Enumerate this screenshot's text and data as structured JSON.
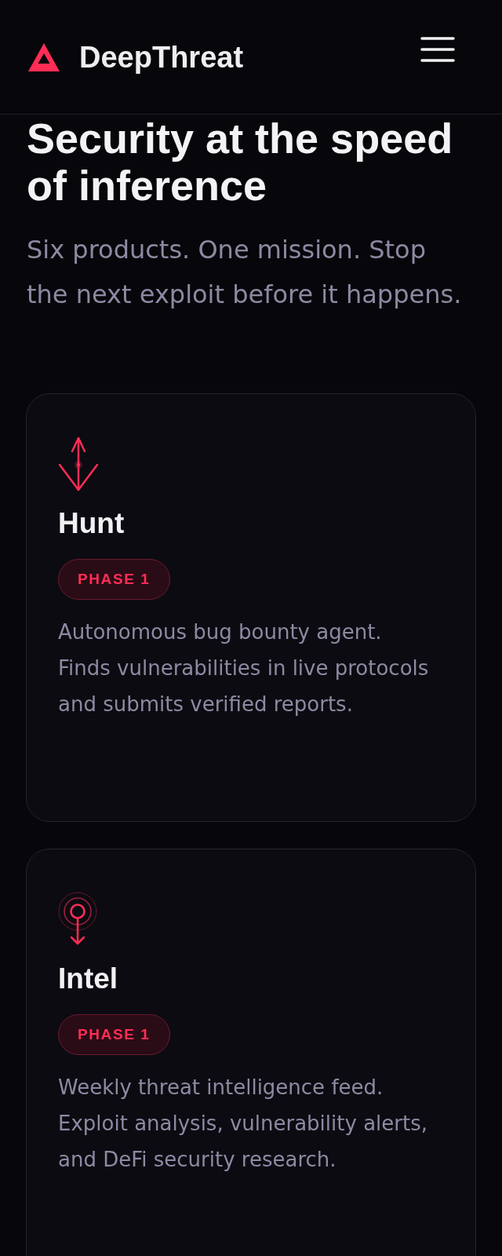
{
  "header": {
    "brand": "DeepThreat"
  },
  "hero": {
    "title": "Security at the speed of inference",
    "subtitle": "Six products. One mission. Stop the next exploit before it happens."
  },
  "products": [
    {
      "kind": "hunt",
      "name": "Hunt",
      "badge": "PHASE 1",
      "description": "Autonomous bug bounty agent. Finds vulnerabilities in live protocols and submits verified reports."
    },
    {
      "kind": "intel",
      "name": "Intel",
      "badge": "PHASE 1",
      "description": "Weekly threat intelligence feed. Exploit analysis, vulnerability alerts, and DeFi security research."
    }
  ]
}
